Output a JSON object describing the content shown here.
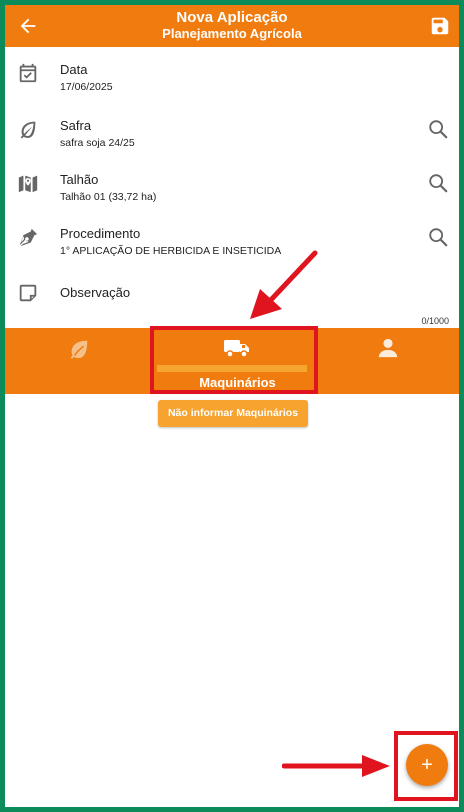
{
  "appbar": {
    "title": "Nova Aplicação",
    "subtitle": "Planejamento Agrícola",
    "back_icon": "arrow-left-icon",
    "save_icon": "save-icon"
  },
  "fields": {
    "data": {
      "label": "Data",
      "value": "17/06/2025",
      "icon": "calendar-check-icon"
    },
    "safra": {
      "label": "Safra",
      "value": "safra soja 24/25",
      "icon": "leaf-icon"
    },
    "talhao": {
      "label": "Talhão",
      "value": "Talhão 01 (33,72 ha)",
      "icon": "map-marker-icon"
    },
    "procedimento": {
      "label": "Procedimento",
      "value": "1° APLICAÇÃO DE HERBICIDA E INSETICIDA",
      "icon": "pen-nib-icon"
    },
    "observacao": {
      "label": "Observação",
      "icon": "note-icon",
      "counter": "0/1000"
    }
  },
  "tabs": {
    "items": [
      {
        "icon": "leaf-icon"
      },
      {
        "icon": "truck-icon",
        "label": "Maquinários",
        "selected": true
      },
      {
        "icon": "user-icon"
      }
    ]
  },
  "no_machinery_button": "Não informar Maquinários",
  "fab_label": "+",
  "colors": {
    "primary": "#f07c10",
    "secondary": "#f6a330",
    "annotation": "#e0141e",
    "frame": "#0b8a5a"
  }
}
